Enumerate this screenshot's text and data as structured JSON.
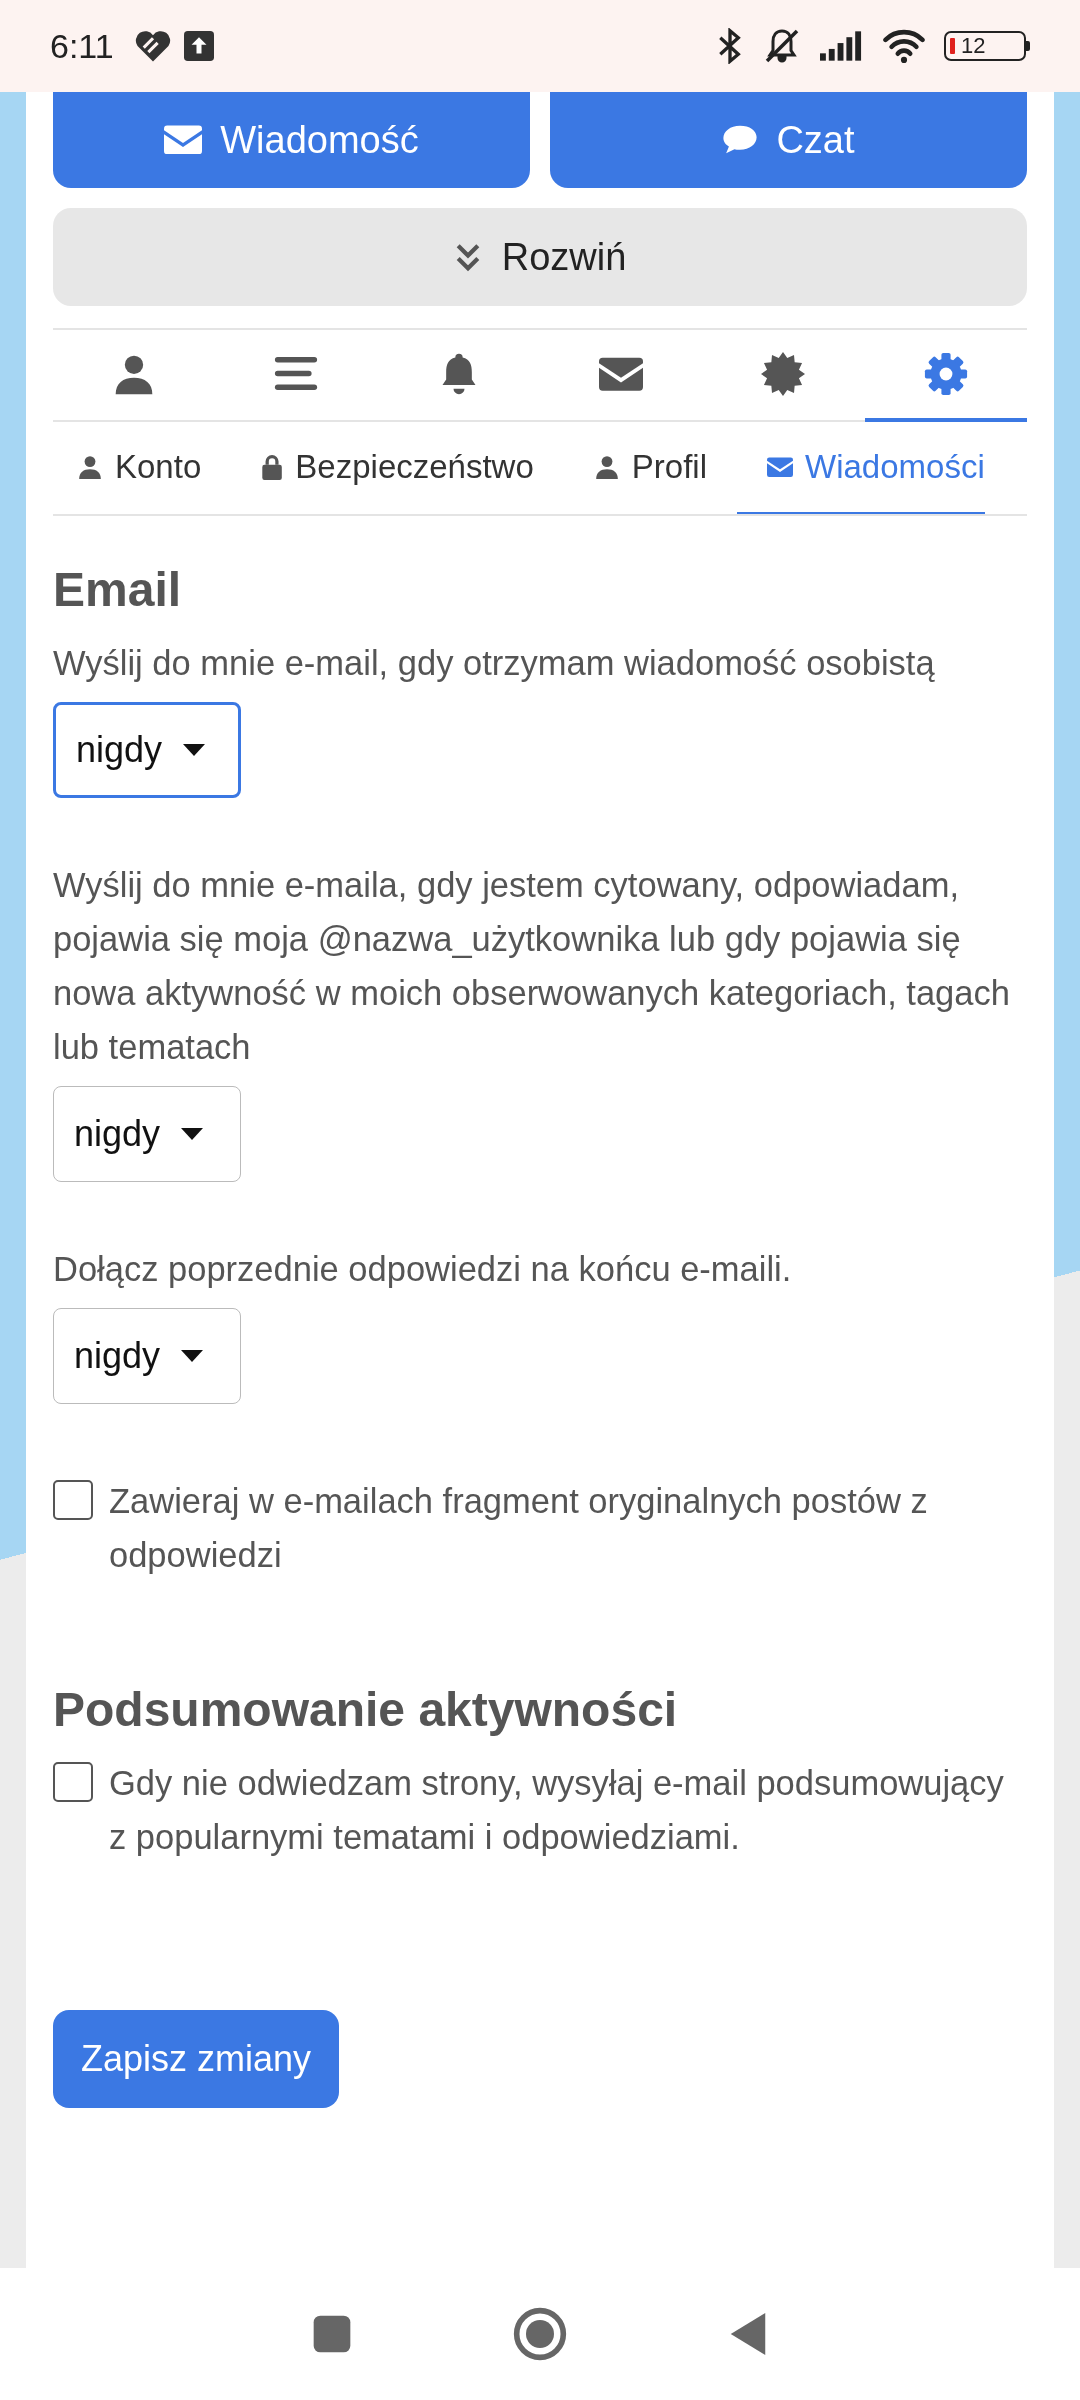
{
  "status_bar": {
    "time": "6:11",
    "battery": "12"
  },
  "action_buttons": [
    {
      "label": "Wiadomość",
      "kind": "mail"
    },
    {
      "label": "Czat",
      "kind": "chat"
    }
  ],
  "expand_button": {
    "label": "Rozwiń"
  },
  "icon_tabs": [
    {
      "kind": "user",
      "selected": false
    },
    {
      "kind": "bars",
      "selected": false
    },
    {
      "kind": "bell",
      "selected": false
    },
    {
      "kind": "mail",
      "selected": false
    },
    {
      "kind": "badge",
      "selected": false
    },
    {
      "kind": "gear",
      "selected": true
    }
  ],
  "settings_tabs": [
    {
      "label": "Konto",
      "kind": "user",
      "selected": false
    },
    {
      "label": "Bezpieczeństwo",
      "kind": "lock",
      "selected": false
    },
    {
      "label": "Profil",
      "kind": "user",
      "selected": false
    },
    {
      "label": "Wiadomości",
      "kind": "mail",
      "selected": true
    }
  ],
  "sections": [
    {
      "heading": "Email",
      "items": [
        {
          "kind": "select",
          "label": "Wyślij do mnie e-mail, gdy otrzymam wiadomość osobistą",
          "value": "nigdy",
          "focused": true
        },
        {
          "kind": "select",
          "label": "Wyślij do mnie e-maila, gdy jestem cytowany, odpowiadam, pojawia się moja @nazwa_użytkownika lub gdy pojawia się nowa aktywność w moich obserwowanych kategoriach, tagach lub tematach",
          "value": "nigdy",
          "focused": false
        },
        {
          "kind": "select",
          "label": "Dołącz poprzednie odpowiedzi na końcu e-maili.",
          "value": "nigdy",
          "focused": false
        },
        {
          "kind": "checkbox",
          "label": "Zawieraj w e-mailach fragment oryginalnych postów z odpowiedzi",
          "checked": false
        }
      ]
    },
    {
      "heading": "Podsumowanie aktywności",
      "items": [
        {
          "kind": "checkbox",
          "label": "Gdy nie odwiedzam strony, wysyłaj e-mail podsumowujący z popularnymi tematami i odpowiedziami.",
          "checked": false
        }
      ]
    }
  ],
  "save_button": {
    "label": "Zapisz zmiany"
  }
}
